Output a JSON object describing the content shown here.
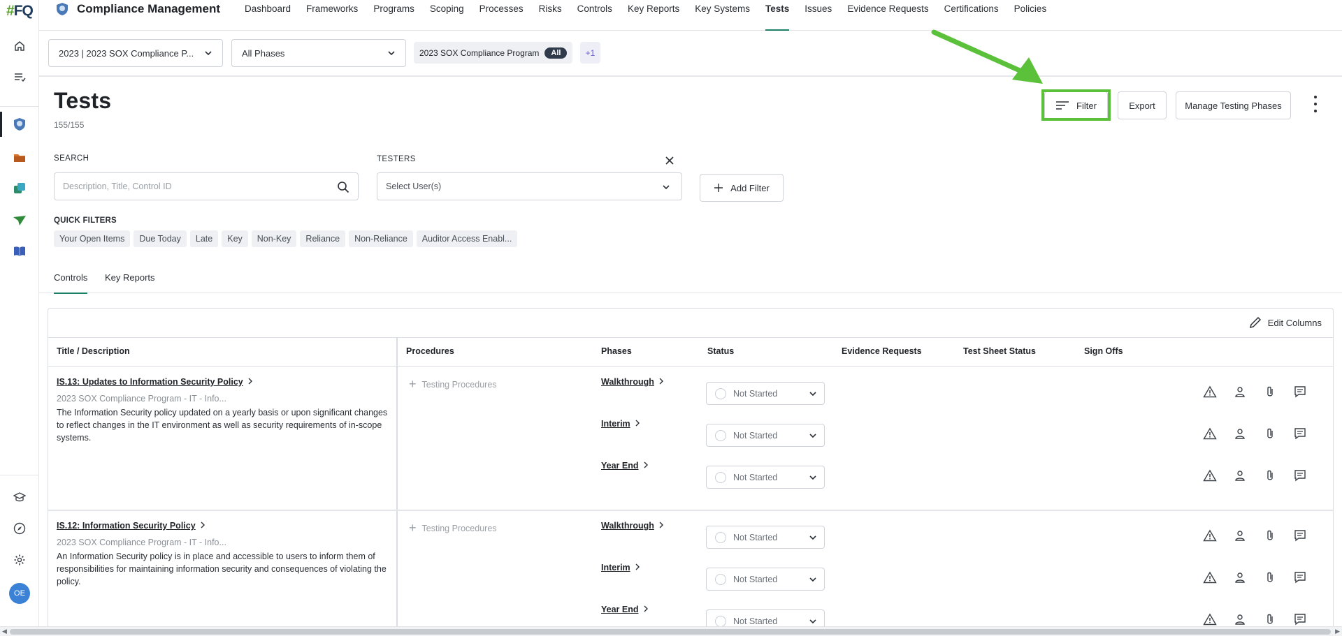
{
  "rail": {
    "logo_hash": "#",
    "logo_q": "FQ",
    "icons": [
      "home-icon",
      "task-list-icon",
      "compliance-shield-icon",
      "folder-icon",
      "sync-icon",
      "send-icon",
      "book-icon",
      "learning-icon",
      "compass-icon",
      "gear-icon"
    ],
    "avatar_initials": "OE"
  },
  "topnav": {
    "brand": "Compliance Management",
    "items": [
      {
        "label": "Dashboard",
        "active": false
      },
      {
        "label": "Frameworks",
        "active": false
      },
      {
        "label": "Programs",
        "active": false
      },
      {
        "label": "Scoping",
        "active": false
      },
      {
        "label": "Processes",
        "active": false
      },
      {
        "label": "Risks",
        "active": false
      },
      {
        "label": "Controls",
        "active": false
      },
      {
        "label": "Key Reports",
        "active": false
      },
      {
        "label": "Key Systems",
        "active": false
      },
      {
        "label": "Tests",
        "active": true
      },
      {
        "label": "Issues",
        "active": false
      },
      {
        "label": "Evidence Requests",
        "active": false
      },
      {
        "label": "Certifications",
        "active": false
      },
      {
        "label": "Policies",
        "active": false
      }
    ]
  },
  "context": {
    "program_select": "2023 | 2023 SOX Compliance P...",
    "phase_select": "All Phases",
    "program_chip": "2023 SOX Compliance Program",
    "program_chip_badge": "All",
    "more_chip": "+1"
  },
  "header": {
    "title": "Tests",
    "count": "155/155",
    "filter_label": "Filter",
    "export_label": "Export",
    "manage_label": "Manage Testing Phases"
  },
  "filters": {
    "search_label": "SEARCH",
    "search_placeholder": "Description, Title, Control ID",
    "testers_label": "TESTERS",
    "testers_placeholder": "Select User(s)",
    "add_filter_label": "Add Filter",
    "quick_filters_label": "QUICK FILTERS",
    "quick_filters": [
      "Your Open Items",
      "Due Today",
      "Late",
      "Key",
      "Non-Key",
      "Reliance",
      "Non-Reliance",
      "Auditor Access Enabl..."
    ]
  },
  "tabs": [
    {
      "label": "Controls",
      "active": true
    },
    {
      "label": "Key Reports",
      "active": false
    }
  ],
  "table": {
    "edit_columns_label": "Edit Columns",
    "columns": [
      "Title / Description",
      "Procedures",
      "Phases",
      "Status",
      "Evidence Requests",
      "Test Sheet Status",
      "Sign Offs"
    ],
    "testing_procedures_label": "Testing Procedures",
    "rows": [
      {
        "title": "IS.13: Updates to Information Security Policy",
        "subtitle": "2023 SOX Compliance Program - IT - Info...",
        "description": "The Information Security policy updated on a yearly basis or upon significant changes to reflect changes in the IT environment as well as security requirements of in-scope systems.",
        "phases": [
          {
            "name": "Walkthrough",
            "status": "Not Started"
          },
          {
            "name": "Interim",
            "status": "Not Started"
          },
          {
            "name": "Year End",
            "status": "Not Started"
          }
        ]
      },
      {
        "title": "IS.12: Information Security Policy",
        "subtitle": "2023 SOX Compliance Program - IT - Info...",
        "description": "An Information Security policy is in place and accessible to users to inform them of responsibilities for maintaining information security and consequences of violating the policy.",
        "phases": [
          {
            "name": "Walkthrough",
            "status": "Not Started"
          },
          {
            "name": "Interim",
            "status": "Not Started"
          },
          {
            "name": "Year End",
            "status": "Not Started"
          }
        ]
      }
    ]
  },
  "colors": {
    "accent_green": "#1a7f64",
    "highlight_green": "#5cc13a",
    "avatar_blue": "#3b82d6"
  }
}
